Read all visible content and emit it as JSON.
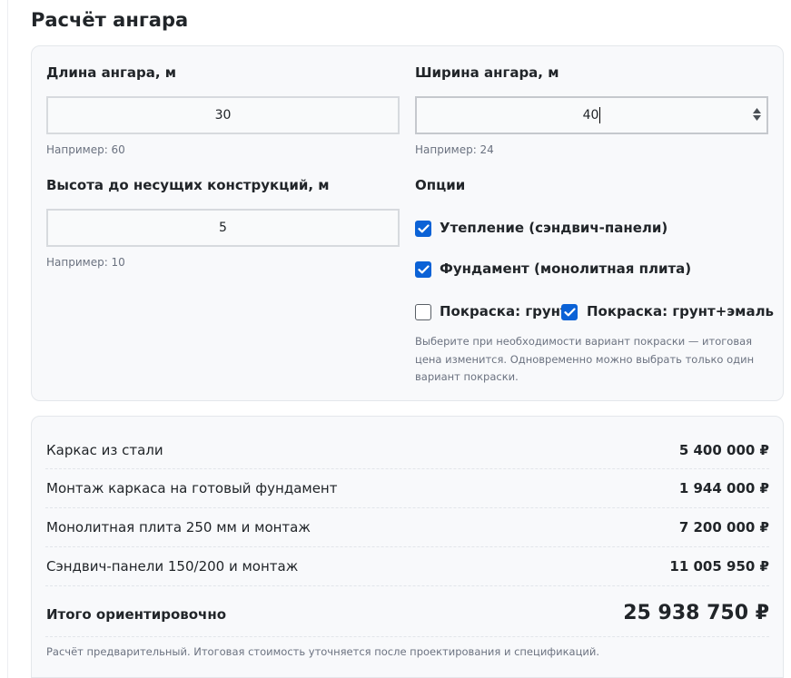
{
  "page": {
    "title": "Расчёт ангара"
  },
  "form": {
    "length": {
      "label": "Длина ангара, м",
      "value": "30",
      "hint": "Например: 60"
    },
    "width": {
      "label": "Ширина ангара, м",
      "value": "40",
      "hint": "Например: 24"
    },
    "height": {
      "label": "Высота до несущих конструкций, м",
      "value": "5",
      "hint": "Например: 10"
    },
    "options": {
      "title": "Опции",
      "insulation": {
        "label": "Утепление (сэндвич-панели)",
        "checked": true
      },
      "foundation": {
        "label": "Фундамент (монолитная плита)",
        "checked": true
      },
      "paint_primer": {
        "label": "Покраска: грунт",
        "checked": false
      },
      "paint_enamel": {
        "label": "Покраска: грунт+эмаль",
        "checked": true
      },
      "note": "Выберите при необходимости вариант покраски — итоговая цена изменится. Одновременно можно выбрать только один вариант покраски."
    }
  },
  "summary": {
    "rows": [
      {
        "label": "Каркас из стали",
        "value": "5 400 000 ₽"
      },
      {
        "label": "Монтаж каркаса на готовый фундамент",
        "value": "1 944 000 ₽"
      },
      {
        "label": "Монолитная плита 250 мм и монтаж",
        "value": "7 200 000 ₽"
      },
      {
        "label": "Сэндвич-панели 150/200 и монтаж",
        "value": "11 005 950 ₽"
      }
    ],
    "total_label": "Итого ориентировочно",
    "total_value": "25 938 750 ₽",
    "footnote": "Расчёт предварительный. Итоговая стоимость уточняется после проектирования и спецификаций."
  },
  "colors": {
    "accent": "#0b62d6",
    "card_background": "#f8f9fb",
    "card_border": "#e4e7eb",
    "muted_text": "#6b7280"
  },
  "icons": {
    "checkbox_checked": "checkmark-icon",
    "spinner": "spinner-arrows-icon"
  }
}
